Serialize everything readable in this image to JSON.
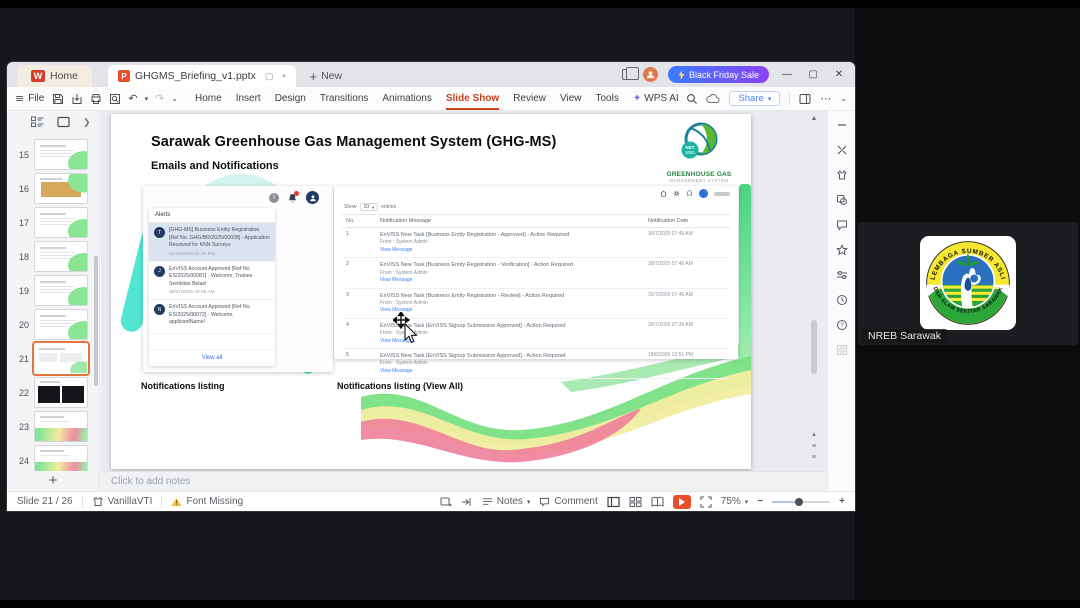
{
  "colors": {
    "accent_orange": "#e8502c",
    "active_menu": "#c8441f",
    "promo_from": "#3a7bff",
    "promo_to": "#8a42f5",
    "link_blue": "#2f6fed",
    "teal": "#52e6d2",
    "selected_thumb_outline": "#e0763a"
  },
  "titlebar": {
    "home_tab": "Home",
    "doc_tab": "GHGMS_Briefing_v1.pptx",
    "new_tab": "New",
    "promo": "Black Friday Sale"
  },
  "ribbon": {
    "file": "File",
    "items": [
      {
        "label": "Home",
        "variant": ""
      },
      {
        "label": "Insert",
        "variant": ""
      },
      {
        "label": "Design",
        "variant": ""
      },
      {
        "label": "Transitions",
        "variant": ""
      },
      {
        "label": "Animations",
        "variant": ""
      },
      {
        "label": "Slide Show",
        "variant": "active"
      },
      {
        "label": "Review",
        "variant": ""
      },
      {
        "label": "View",
        "variant": ""
      },
      {
        "label": "Tools",
        "variant": ""
      }
    ],
    "wps_ai": "WPS AI",
    "share": "Share"
  },
  "sidebar": {
    "slides": [
      {
        "num": "15",
        "variant": "lines",
        "sel": ""
      },
      {
        "num": "16",
        "variant": "orange",
        "sel": ""
      },
      {
        "num": "17",
        "variant": "lines",
        "sel": ""
      },
      {
        "num": "18",
        "variant": "lines",
        "sel": ""
      },
      {
        "num": "19",
        "variant": "lines",
        "sel": ""
      },
      {
        "num": "20",
        "variant": "lines",
        "sel": ""
      },
      {
        "num": "21",
        "variant": "current",
        "sel": "sel"
      },
      {
        "num": "22",
        "variant": "dark",
        "sel": ""
      },
      {
        "num": "23",
        "variant": "wave",
        "sel": ""
      },
      {
        "num": "24",
        "variant": "wave",
        "sel": ""
      }
    ]
  },
  "slide": {
    "title": "Sarawak Greenhouse Gas Management System (GHG-MS)",
    "subtitle": "Emails and Notifications",
    "logo": {
      "badge_line1": "NET",
      "badge_line2": "2050",
      "name_line1": "GREENHOUSE GAS",
      "name_line2": "MANAGEMENT SYSTEM"
    },
    "alerts": {
      "header": "Alerts",
      "view_all": "View all",
      "items": [
        {
          "avatar": "T",
          "text": "[GHG-MS] Business Entity Registration [Ref No. GHG/BR/2025/00028] - Application Received for KNN Surveys",
          "date": "21/10/2025 02:19 PM",
          "variant": "hl"
        },
        {
          "avatar": "J",
          "text": "EnVISS Account Approved [Ref No. ES/2025/00081] - Welcome, Trainee Sembilan Belas!",
          "date": "30/07/2025 09:09 AM",
          "variant": ""
        },
        {
          "avatar": "N",
          "text": "EnVISS Account Approved [Ref No. ES/2025/00072] - Welcome, applicantName!",
          "date": "",
          "variant": ""
        }
      ]
    },
    "table": {
      "show": "Show",
      "page_size": "10",
      "entries": "entries",
      "headers": {
        "no": "No.",
        "message": "Notification Message",
        "date": "Notification Date"
      },
      "rows": [
        {
          "no": "1",
          "msg": "EnVISS New Task [Business Entity Registration - Approved] - Action Required",
          "from": "From : System Admin",
          "link": "View Message",
          "date": "30/7/2025 07:49 AM"
        },
        {
          "no": "2",
          "msg": "EnVISS New Task [Business Entity Registration - Verification] - Action Required",
          "from": "From : System Admin",
          "link": "View Message",
          "date": "30/7/2025 07:48 AM"
        },
        {
          "no": "3",
          "msg": "EnVISS New Task [Business Entity Registration - Review] - Action Required",
          "from": "From : System Admin",
          "link": "View Message",
          "date": "30/7/2025 07:46 AM"
        },
        {
          "no": "4",
          "msg": "EnVISS New Task [EnVISS Signup Submission Approved] - Action Required",
          "from": "From : System Admin",
          "link": "View Message",
          "date": "30/7/2025 07:39 AM"
        },
        {
          "no": "5",
          "msg": "EnVISS New Task [EnVISS Signup Submission Approved] - Action Required",
          "from": "From : System Admin",
          "link": "View Message",
          "date": "18/6/2025 12:51 PM"
        }
      ]
    },
    "captions": {
      "left": "Notifications listing",
      "right": "Notifications listing (View All)"
    }
  },
  "notes_bar": {
    "placeholder": "Click to add notes"
  },
  "statusbar": {
    "slide_indicator": "Slide 21 / 26",
    "theme_name": "VanillaVTI",
    "font_warning": "Font Missing",
    "notes": "Notes",
    "comment": "Comment",
    "zoom_level": "75%"
  },
  "participant": {
    "name": "NREB Sarawak",
    "logo_top_text": "LEMBAGA SUMBER ASLI",
    "logo_bottom_text": "DAN ALAM SEKITAR SARAWAK"
  }
}
